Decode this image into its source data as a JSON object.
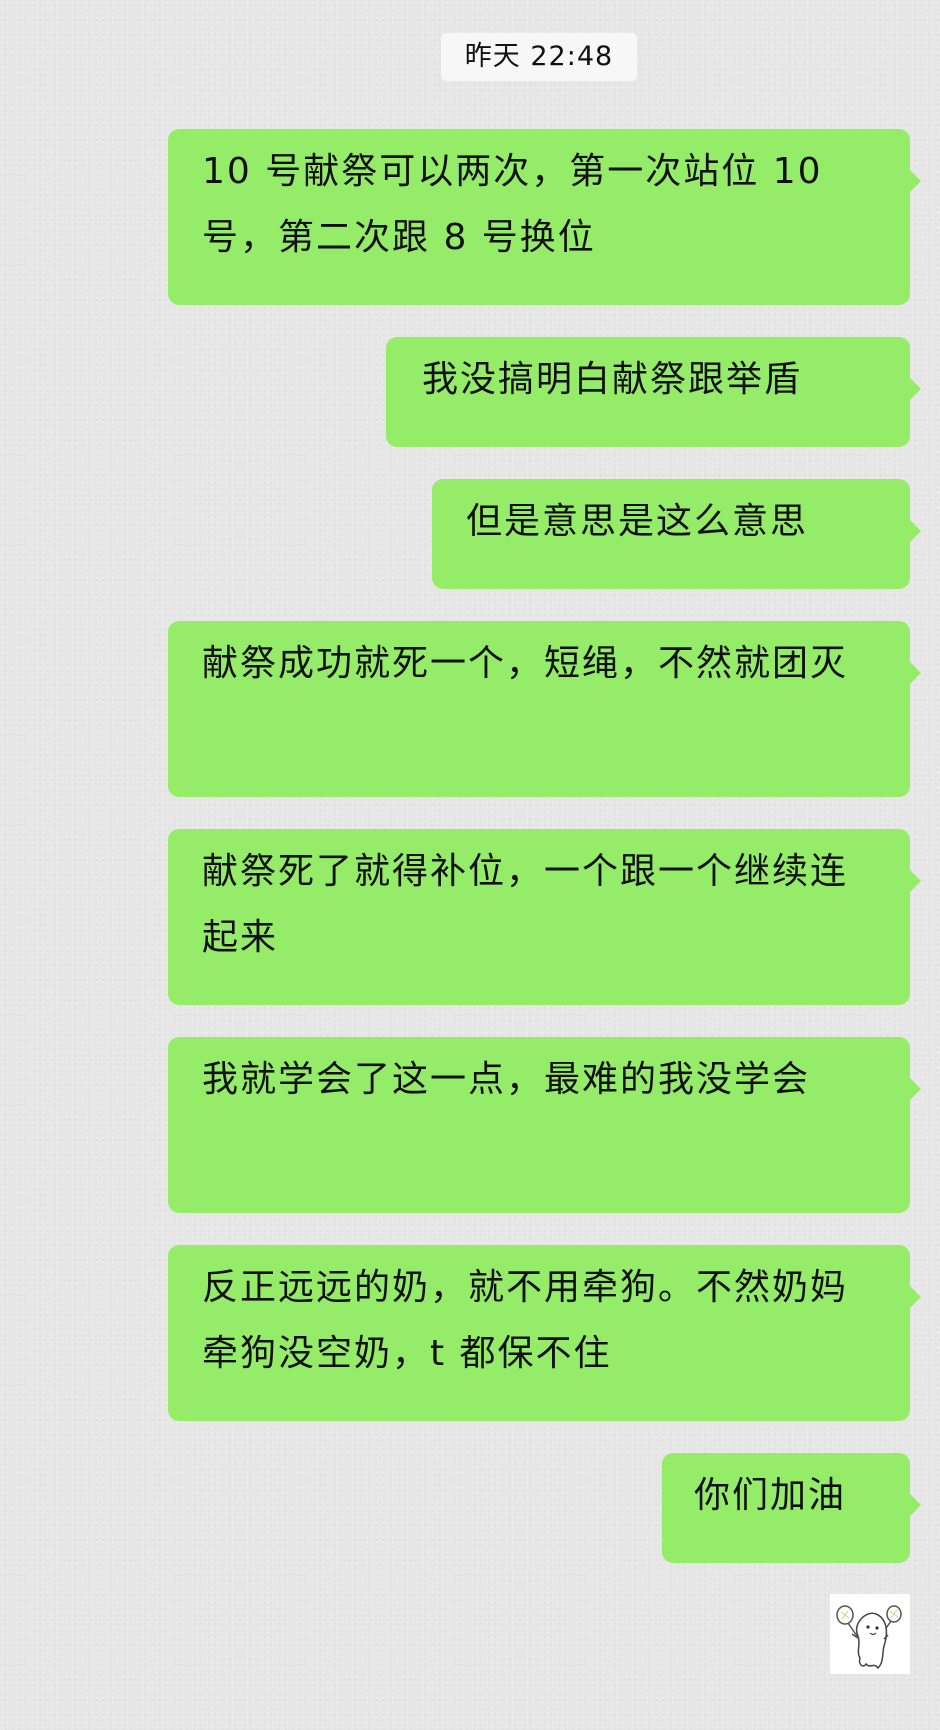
{
  "chat": {
    "timestamp": "昨天 22:48",
    "messages": [
      {
        "text": "10 号献祭可以两次，第一次站位 10 号，第二次跟 8 号换位"
      },
      {
        "text": "我没搞明白献祭跟举盾"
      },
      {
        "text": "但是意思是这么意思"
      },
      {
        "text": "献祭成功就死一个，短绳，不然就团灭"
      },
      {
        "text": "献祭死了就得补位，一个跟一个继续连起来"
      },
      {
        "text": "我就学会了这一点，最难的我没学会"
      },
      {
        "text": "反正远远的奶，就不用牵狗。不然奶妈牵狗没空奶，t 都保不住"
      },
      {
        "text": "你们加油"
      }
    ],
    "bubble_color": "#95ec69",
    "sticker": {
      "icon": "cartoon-ghost-with-rackets-sticker"
    }
  }
}
